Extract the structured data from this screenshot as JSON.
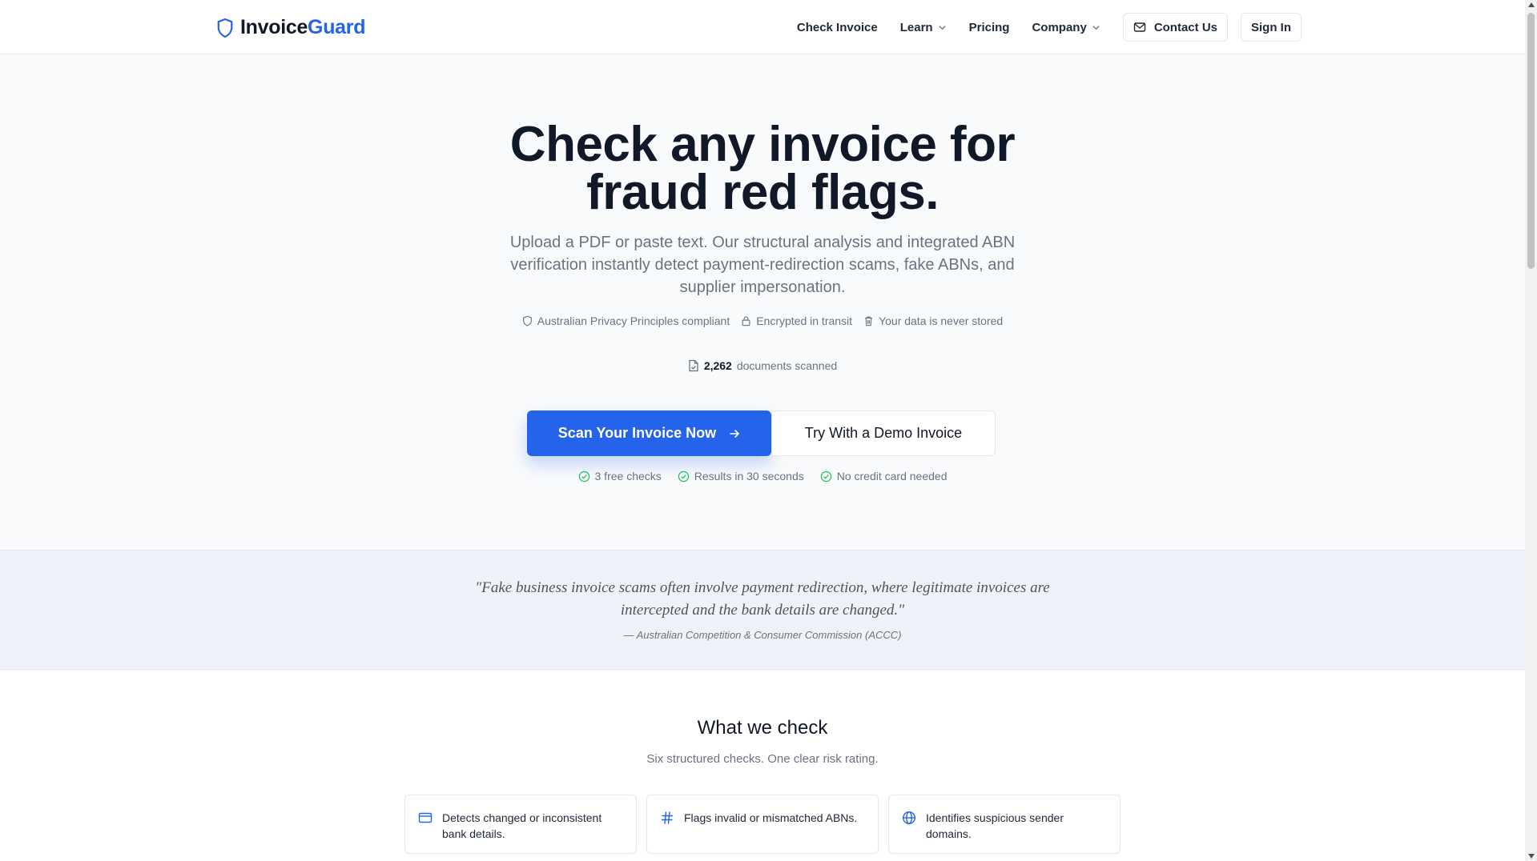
{
  "brand": {
    "name_part1": "Invoice",
    "name_part2": "Guard"
  },
  "nav": {
    "check_invoice": "Check Invoice",
    "learn": "Learn",
    "pricing": "Pricing",
    "company": "Company",
    "contact": "Contact Us",
    "sign_in": "Sign In"
  },
  "hero": {
    "title_line1": "Check any invoice for",
    "title_line2": "fraud red flags.",
    "subtitle": "Upload a PDF or paste text. Our structural analysis and integrated ABN verification instantly detect payment-redirection scams, fake ABNs, and supplier impersonation.",
    "trust": [
      "Australian Privacy Principles compliant",
      "Encrypted in transit",
      "Your data is never stored"
    ],
    "count_value": "2,262",
    "count_label": "documents scanned",
    "cta_primary": "Scan Your Invoice Now",
    "cta_secondary": "Try With a Demo Invoice",
    "perks": [
      "3 free checks",
      "Results in 30 seconds",
      "No credit card needed"
    ]
  },
  "quote": {
    "text": "\"Fake business invoice scams often involve payment redirection, where legitimate invoices are intercepted and the bank details are changed.\"",
    "source": "— Australian Competition & Consumer Commission (ACCC)"
  },
  "checks": {
    "title": "What we check",
    "subtitle": "Six structured checks. One clear risk rating.",
    "cards": [
      {
        "icon": "credit-card-icon",
        "text": "Detects changed or inconsistent bank details."
      },
      {
        "icon": "hash-icon",
        "text": "Flags invalid or mismatched ABNs."
      },
      {
        "icon": "globe-icon",
        "text": "Identifies suspicious sender domains."
      }
    ]
  },
  "colors": {
    "accent": "#2563eb",
    "success": "#22c55e",
    "text": "#111827",
    "muted": "#6b7280"
  }
}
